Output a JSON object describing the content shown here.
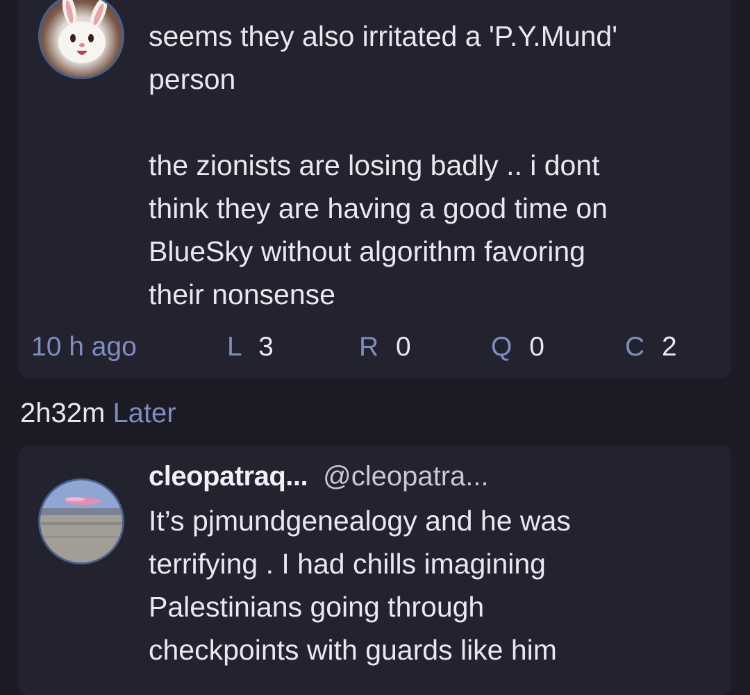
{
  "posts": [
    {
      "text": "seems they also irritated a 'P.Y.Mund'\nperson\n\nthe zionists are losing badly .. i dont\nthink they are having a good time on\nBlueSky without algorithm favoring\ntheir nonsense",
      "timestamp": "10 h ago",
      "stats": [
        {
          "letter": "L",
          "count": "3"
        },
        {
          "letter": "R",
          "count": "0"
        },
        {
          "letter": "Q",
          "count": "0"
        },
        {
          "letter": "C",
          "count": "2"
        }
      ]
    },
    {
      "display_name": "cleopatraq...",
      "handle": "@cleopatra...",
      "text": "It’s pjmundgenealogy and he was\nterrifying . I had chills imagining\nPalestinians going through\ncheckpoints with guards like him"
    }
  ],
  "gap": {
    "duration": "2h32m",
    "label": "Later"
  },
  "colors": {
    "background": "#1b1a25",
    "card": "#23222f",
    "accent": "#7f8ebe",
    "text": "#e9e8f0"
  },
  "icons": {
    "avatar1": "white-rabbit-avatar",
    "avatar2": "sunset-beach-avatar"
  }
}
